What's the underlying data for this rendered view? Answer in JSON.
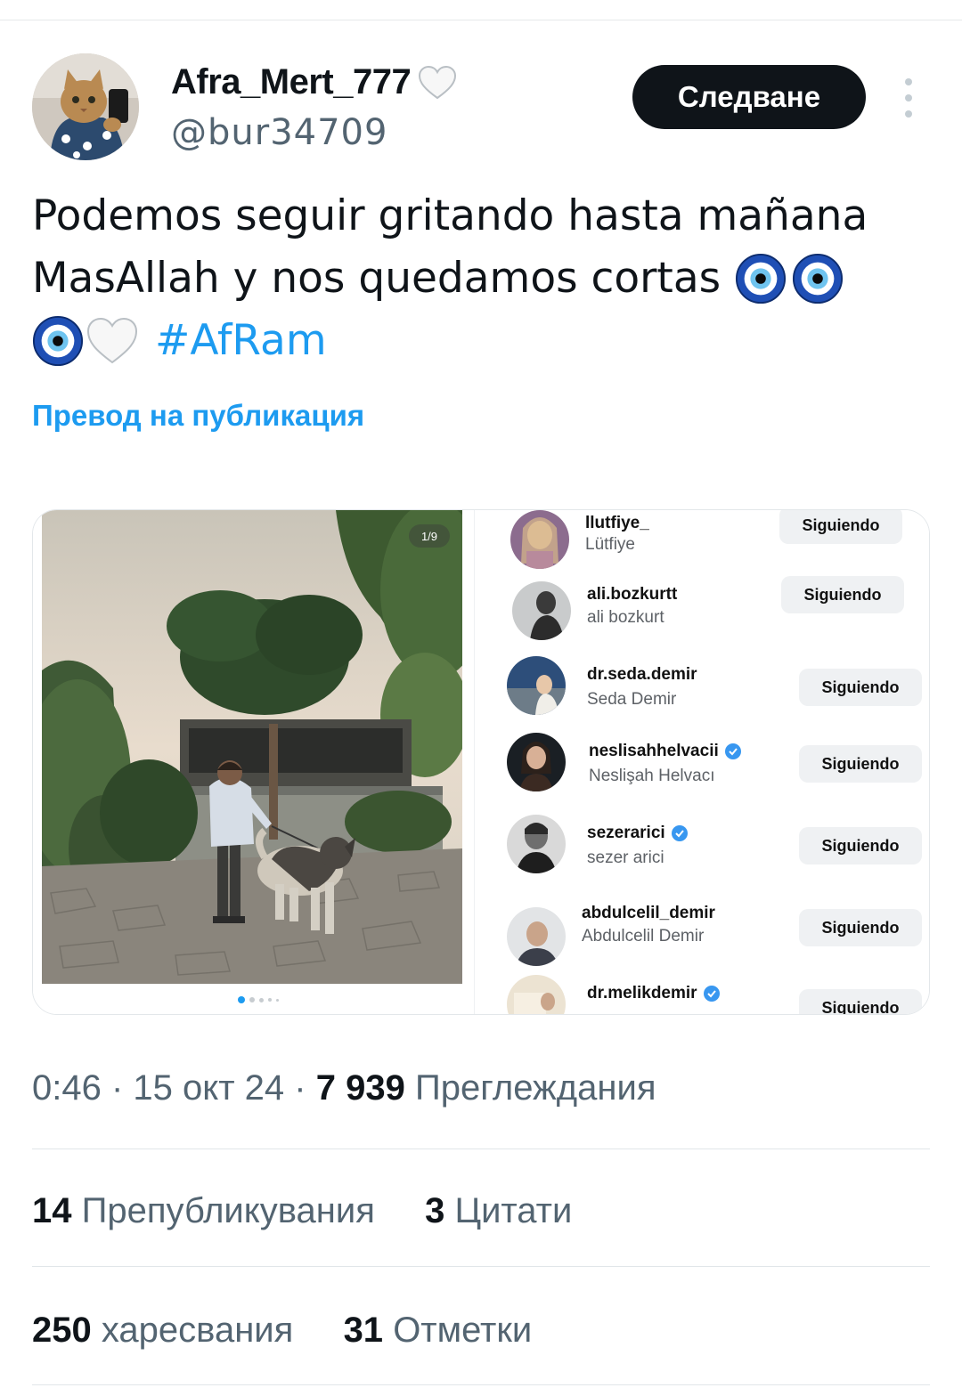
{
  "author": {
    "display_name": "Afra_Mert_777",
    "handle": "@bur34709",
    "name_emoji": "white-heart-icon"
  },
  "actions": {
    "follow_label": "Следване",
    "more_icon": "more-vertical-icon"
  },
  "tweet": {
    "line1": "Podemos seguir gritando hasta mañana",
    "line2": "MasAllah y nos quedamos cortas",
    "hashtag": "#AfRam",
    "emojis": [
      "nazar-amulet-icon",
      "nazar-amulet-icon",
      "nazar-amulet-icon",
      "white-heart-icon"
    ],
    "translate_label": "Превод на публикация"
  },
  "media": {
    "left_counter": "1/9",
    "following_list": [
      {
        "username": "llutfiye_",
        "full_name": "Lütfiye",
        "button": "Siguiendo",
        "verified": false
      },
      {
        "username": "ali.bozkurtt",
        "full_name": "ali bozkurt",
        "button": "Siguiendo",
        "verified": false
      },
      {
        "username": "dr.seda.demir",
        "full_name": "Seda Demir",
        "button": "Siguiendo",
        "verified": false
      },
      {
        "username": "neslisahhelvacii",
        "full_name": "Neslişah Helvacı",
        "button": "Siguiendo",
        "verified": true
      },
      {
        "username": "sezerarici",
        "full_name": "sezer arici",
        "button": "Siguiendo",
        "verified": true
      },
      {
        "username": "abdulcelil_demir",
        "full_name": "Abdulcelil Demir",
        "button": "Siguiendo",
        "verified": false
      },
      {
        "username": "dr.melikdemir",
        "full_name": "",
        "button": "Siguiendo",
        "verified": true
      }
    ]
  },
  "meta": {
    "time": "0:46",
    "date": "15 окт 24",
    "views_count": "7 939",
    "views_label": "Преглеждания"
  },
  "stats": {
    "reposts_count": "14",
    "reposts_label": "Препубликувания",
    "quotes_count": "3",
    "quotes_label": "Цитати",
    "likes_count": "250",
    "likes_label": "харесвания",
    "bookmarks_count": "31",
    "bookmarks_label": "Отметки"
  },
  "colors": {
    "accent": "#1d9bf0",
    "text": "#0f1419",
    "secondary": "#536471",
    "button_dark": "#0f1419"
  }
}
